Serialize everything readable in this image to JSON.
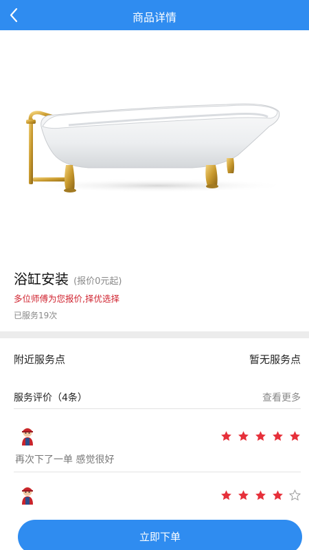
{
  "header": {
    "title": "商品详情",
    "back_icon": "chevron-left-icon"
  },
  "product": {
    "image": "bathtub-image",
    "name": "浴缸安装",
    "price_note": "(报价0元起)",
    "tip": "多位师傅为您报价,择优选择",
    "served": "已服务19次"
  },
  "nearby": {
    "label": "附近服务点",
    "value": "暂无服务点"
  },
  "reviews_header": {
    "label": "服务评价（4条）",
    "more": "查看更多"
  },
  "reviews": [
    {
      "avatar": "avatar-icon",
      "rating": 5,
      "comment": "再次下了一单 感觉很好"
    },
    {
      "avatar": "avatar-icon",
      "rating": 4,
      "comment": ""
    }
  ],
  "footer": {
    "order_label": "立即下单"
  },
  "colors": {
    "brand": "#2f8cf0",
    "tip_red": "#d0232f",
    "star_red": "#e6303a"
  }
}
